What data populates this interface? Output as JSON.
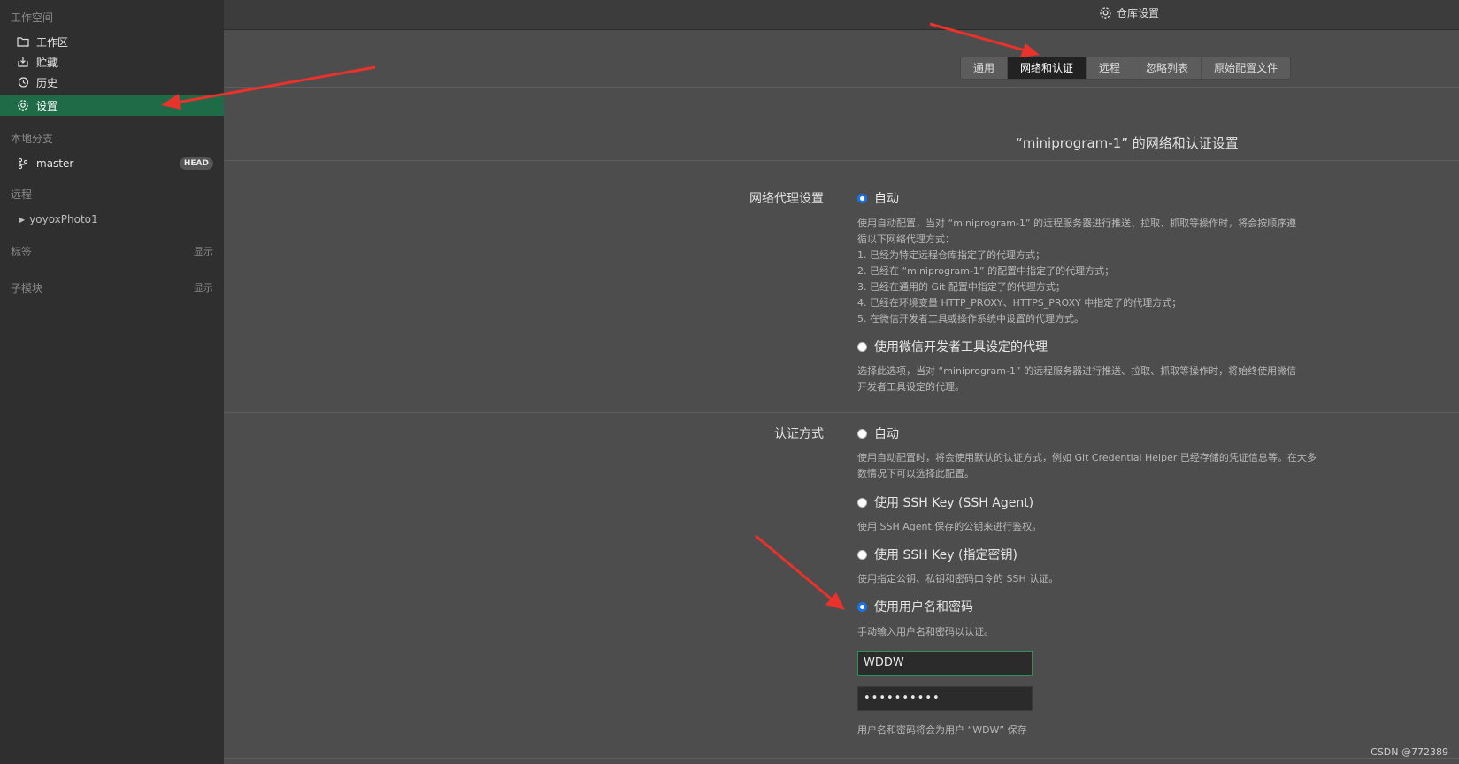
{
  "sidebar": {
    "workspace_title": "工作空间",
    "items": [
      {
        "label": "工作区",
        "icon": "folder-icon"
      },
      {
        "label": "贮藏",
        "icon": "stash-icon"
      },
      {
        "label": "历史",
        "icon": "history-icon"
      },
      {
        "label": "设置",
        "icon": "gear-icon",
        "active": true
      }
    ],
    "local_branches_title": "本地分支",
    "branch": {
      "name": "master",
      "badge": "HEAD",
      "icon": "branch-icon"
    },
    "remote_title": "远程",
    "remote_item": "yoyoxPhoto1",
    "tags_title": "标签",
    "tags_show": "显示",
    "submodules_title": "子模块",
    "submodules_show": "显示"
  },
  "topbar": {
    "title": "仓库设置",
    "icon": "gear-icon"
  },
  "tabs": [
    {
      "label": "通用"
    },
    {
      "label": "网络和认证",
      "active": true
    },
    {
      "label": "远程"
    },
    {
      "label": "忽略列表"
    },
    {
      "label": "原始配置文件"
    }
  ],
  "page_title": "“miniprogram-1” 的网络和认证设置",
  "proxy": {
    "label": "网络代理设置",
    "auto_label": "自动",
    "auto_selected": true,
    "auto_desc": [
      "使用自动配置，当对 “miniprogram-1” 的远程服务器进行推送、拉取、抓取等操作时，将会按顺序遵",
      "循以下网络代理方式：",
      "1. 已经为特定远程仓库指定了的代理方式；",
      "2. 已经在 “miniprogram-1” 的配置中指定了的代理方式；",
      "3. 已经在通用的 Git 配置中指定了的代理方式；",
      "4. 已经在环境变量 HTTP_PROXY、HTTPS_PROXY 中指定了的代理方式；",
      "5. 在微信开发者工具或操作系统中设置的代理方式。"
    ],
    "wechat_label": "使用微信开发者工具设定的代理",
    "wechat_selected": false,
    "wechat_desc": [
      "选择此选项，当对 “miniprogram-1” 的远程服务器进行推送、拉取、抓取等操作时，将始终使用微信",
      "开发者工具设定的代理。"
    ]
  },
  "auth": {
    "label": "认证方式",
    "auto_label": "自动",
    "auto_selected": false,
    "auto_desc": [
      "使用自动配置时，将会使用默认的认证方式，例如 Git Credential Helper 已经存储的凭证信息等。在大多",
      "数情况下可以选择此配置。"
    ],
    "ssh_agent_label": "使用 SSH Key (SSH Agent)",
    "ssh_agent_selected": false,
    "ssh_agent_desc": "使用 SSH Agent 保存的公钥来进行鉴权。",
    "ssh_key_label": "使用 SSH Key (指定密钥)",
    "ssh_key_selected": false,
    "ssh_key_desc": "使用指定公钥、私钥和密码口令的 SSH 认证。",
    "userpass_label": "使用用户名和密码",
    "userpass_selected": true,
    "userpass_desc": "手动输入用户名和密码以认证。",
    "username_value": "WDDW",
    "password_value": "••••••••••",
    "save_note": "用户名和密码将会为用户 “WDW” 保存"
  },
  "watermark": "CSDN @772389",
  "colors": {
    "accent": "#1f6b48",
    "arrow": "#e8322b",
    "radio_on": "#1a73e8"
  }
}
